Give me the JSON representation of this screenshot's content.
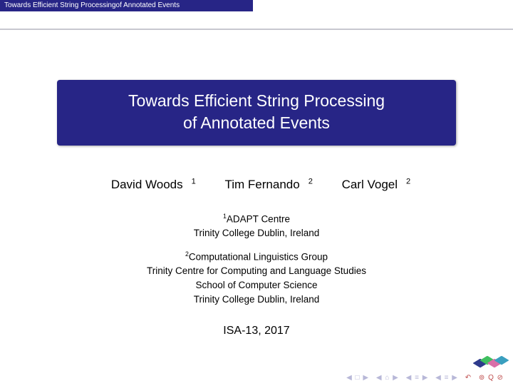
{
  "header": {
    "runningTitle": "Towards Efficient String Processingof Annotated Events"
  },
  "title": {
    "line1": "Towards Efficient String Processing",
    "line2": "of Annotated Events"
  },
  "authors": [
    {
      "name": "David Woods",
      "affMark": "1"
    },
    {
      "name": "Tim Fernando",
      "affMark": "2"
    },
    {
      "name": "Carl Vogel",
      "affMark": "2"
    }
  ],
  "affiliations": {
    "a1": {
      "mark": "1",
      "lines": [
        "ADAPT Centre",
        "Trinity College Dublin, Ireland"
      ]
    },
    "a2": {
      "mark": "2",
      "lines": [
        "Computational Linguistics Group",
        "Trinity Centre for Computing and Language Studies",
        "School of Computer Science",
        "Trinity College Dublin, Ireland"
      ]
    }
  },
  "venue": "ISA-13, 2017",
  "nav": {
    "first": "◀ □ ▶",
    "prev": "◀ ⌂ ▶",
    "next": "◀ ≡ ▶",
    "last": "◀ ≡ ▶",
    "back": "↶",
    "menu": "⊚ Q ⊘"
  }
}
